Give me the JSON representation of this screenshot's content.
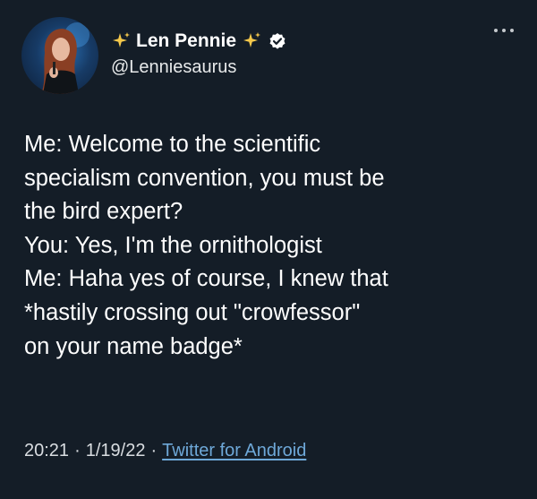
{
  "author": {
    "display_name": "Len Pennie",
    "handle": "@Lenniesaurus",
    "verified": true,
    "name_decoration_icon": "sparkles-icon"
  },
  "tweet": {
    "lines": [
      "Me: Welcome to the scientific",
      "specialism convention, you must be",
      "the bird expert?",
      "You: Yes, I'm the ornithologist",
      "Me: Haha yes of course, I knew that",
      "*hastily crossing out \"crowfessor\"",
      "on your name badge*"
    ],
    "time": "20:21",
    "date": "1/19/22",
    "separator": "·",
    "source": "Twitter for Android"
  },
  "colors": {
    "background": "#141d27",
    "text": "#ffffff",
    "link": "#6ea8d8",
    "sparkle": "#f5c84b"
  }
}
